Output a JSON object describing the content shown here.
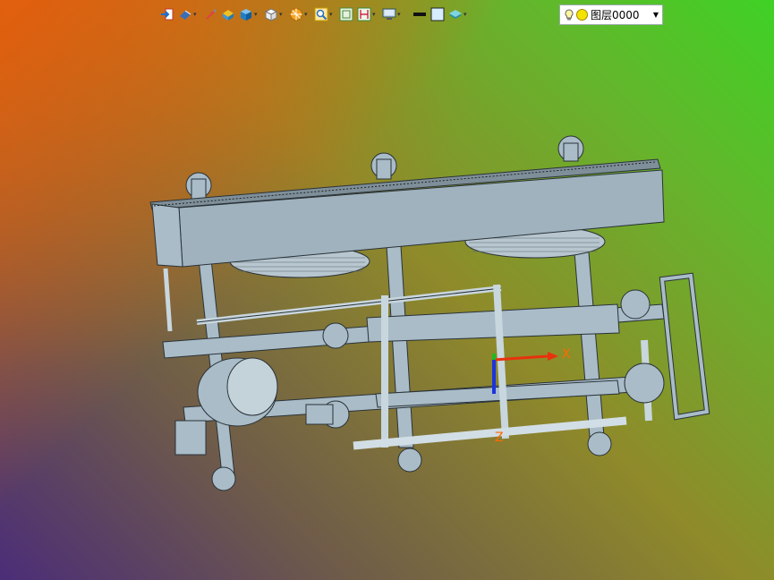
{
  "toolbar": {
    "icons": [
      {
        "name": "exit-icon",
        "has_menu": false
      },
      {
        "name": "view-orient-icon",
        "has_menu": true
      },
      {
        "name": "brush-icon",
        "has_menu": false
      },
      {
        "name": "shaded-solid-icon",
        "has_menu": false
      },
      {
        "name": "cube-blue-icon",
        "has_menu": true
      },
      {
        "name": "cube-white-icon",
        "has_menu": true
      },
      {
        "name": "section-view-icon",
        "has_menu": true
      },
      {
        "name": "zoom-fit-icon",
        "has_menu": true
      },
      {
        "name": "frame-icon",
        "has_menu": false
      },
      {
        "name": "ruler-icon",
        "has_menu": true
      },
      {
        "name": "monitor-icon",
        "has_menu": true
      },
      {
        "name": "line-black-icon",
        "has_menu": false
      },
      {
        "name": "box-light-icon",
        "has_menu": false
      },
      {
        "name": "layers-icon",
        "has_menu": true
      }
    ]
  },
  "layer": {
    "name": "图层0000"
  },
  "triad": {
    "x_label": "X",
    "z_label": "Z"
  },
  "colors": {
    "part_fill": "#a9bcc8",
    "part_stroke": "#2a3238",
    "axis_x": "#e8320c",
    "axis_y": "#1fb91f",
    "axis_z": "#1c33e0",
    "triad_label": "#ff6a00"
  }
}
